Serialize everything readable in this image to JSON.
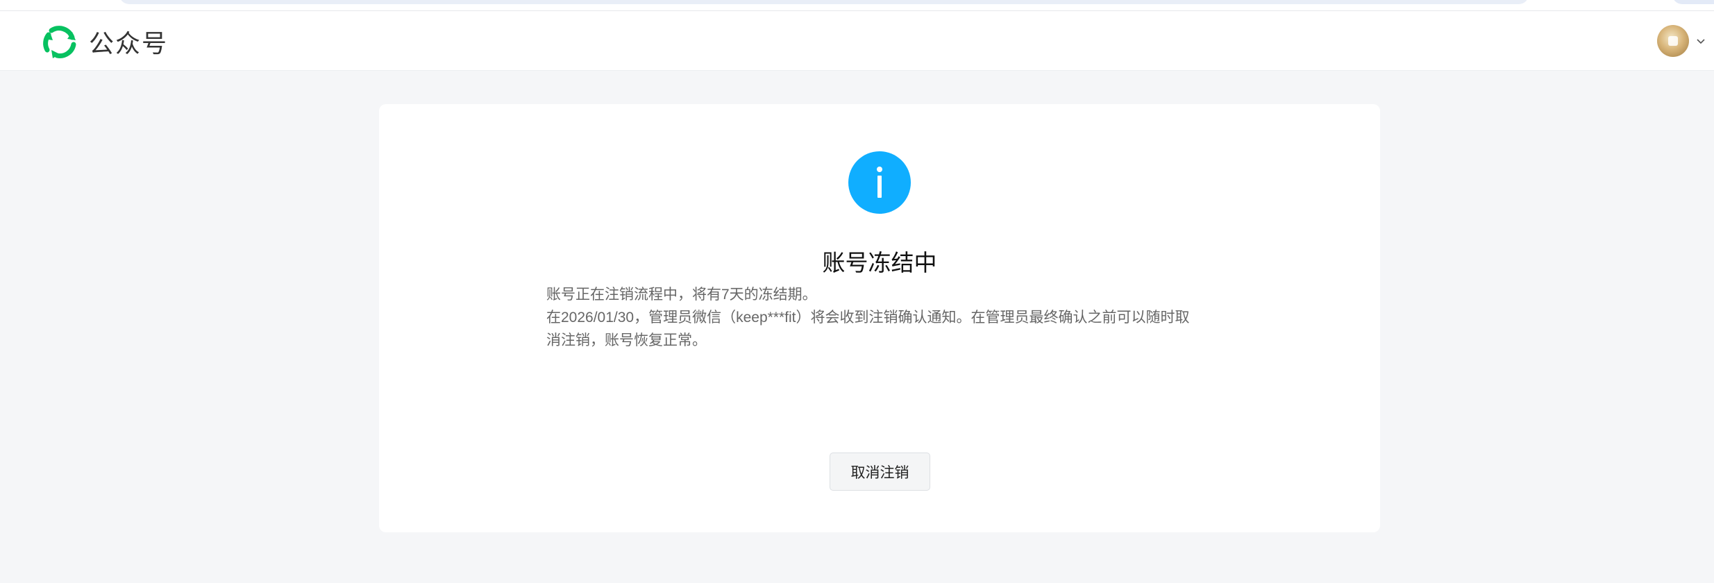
{
  "header": {
    "brand_name": "公众号",
    "logo_icon": "wechat-official-account-logo-icon",
    "user_menu_icon": "chevron-down-icon"
  },
  "main": {
    "status_icon": "info-icon",
    "title": "账号冻结中",
    "description_lines": [
      "账号正在注销流程中，将有7天的冻结期。",
      "在2026/01/30，管理员微信（keep***fit）将会收到注销确认通知。在管理员最终确认之前可以随时取消注销，账号恢复正常。"
    ],
    "cancel_button_label": "取消注销"
  },
  "colors": {
    "brand_green": "#07c160",
    "info_blue": "#10aeff",
    "page_bg": "#f5f6f8"
  }
}
